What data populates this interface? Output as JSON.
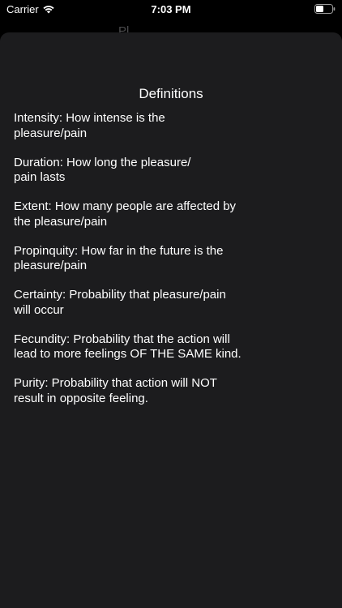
{
  "status_bar": {
    "carrier": "Carrier",
    "time": "7:03 PM",
    "wifi_icon": "wifi-icon",
    "battery_icon": "battery-icon"
  },
  "underlying": {
    "title": "Pl"
  },
  "sheet": {
    "title": "Definitions",
    "background": "#1c1c1e",
    "definitions": [
      "Intensity: How intense is the\npleasure/pain",
      "Duration: How long the pleasure/\npain lasts",
      "Extent: How many people are affected by\nthe pleasure/pain",
      "Propinquity: How far in the future is the\npleasure/pain",
      "Certainty: Probability that pleasure/pain\nwill occur",
      "Fecundity: Probability that the action will\nlead to more feelings OF THE SAME kind.",
      "Purity: Probability that action will NOT\nresult in opposite feeling."
    ]
  }
}
